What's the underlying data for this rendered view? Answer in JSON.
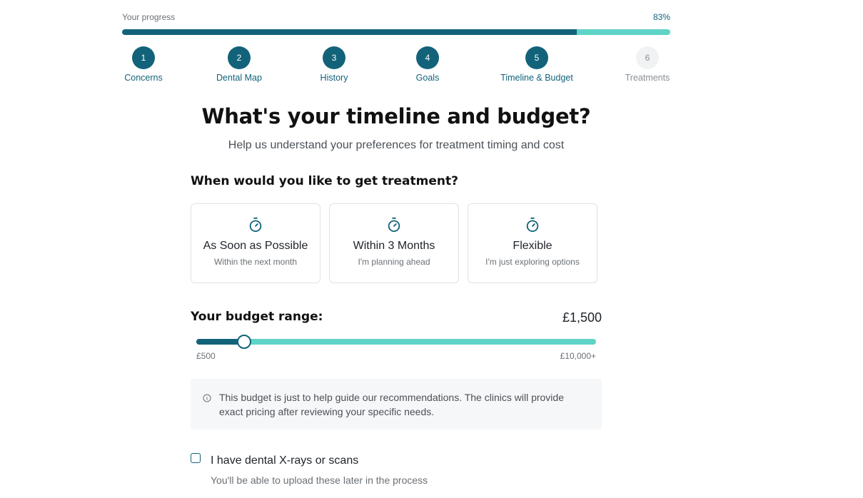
{
  "progress": {
    "label": "Your progress",
    "percent_text": "83%",
    "fraction": 0.83,
    "colors": {
      "accent": "#12637a",
      "track": "#5fd3c6"
    }
  },
  "steps": [
    {
      "number": "1",
      "label": "Concerns",
      "state": "complete"
    },
    {
      "number": "2",
      "label": "Dental Map",
      "state": "complete"
    },
    {
      "number": "3",
      "label": "History",
      "state": "complete"
    },
    {
      "number": "4",
      "label": "Goals",
      "state": "complete"
    },
    {
      "number": "5",
      "label": "Timeline & Budget",
      "state": "current"
    },
    {
      "number": "6",
      "label": "Treatments",
      "state": "upcoming"
    }
  ],
  "page": {
    "title": "What's your timeline and budget?",
    "subtitle": "Help us understand your preferences for treatment timing and cost"
  },
  "timeline": {
    "question": "When would you like to get treatment?",
    "options": [
      {
        "icon": "stopwatch-icon",
        "title": "As Soon as Possible",
        "subtitle": "Within the next month"
      },
      {
        "icon": "stopwatch-icon",
        "title": "Within 3 Months",
        "subtitle": "I'm planning ahead"
      },
      {
        "icon": "stopwatch-icon",
        "title": "Flexible",
        "subtitle": "I'm just exploring options"
      }
    ]
  },
  "budget": {
    "label": "Your budget range:",
    "value_text": "£1,500",
    "slider_fraction": 0.12,
    "min_label": "£500",
    "max_label": "£10,000+"
  },
  "notice": {
    "icon": "info-icon",
    "text": "This budget is just to help guide our recommendations. The clinics will provide exact pricing after reviewing your specific needs."
  },
  "xrays": {
    "checked": false,
    "label": "I have dental X-rays or scans",
    "hint": "You'll be able to upload these later in the process"
  }
}
